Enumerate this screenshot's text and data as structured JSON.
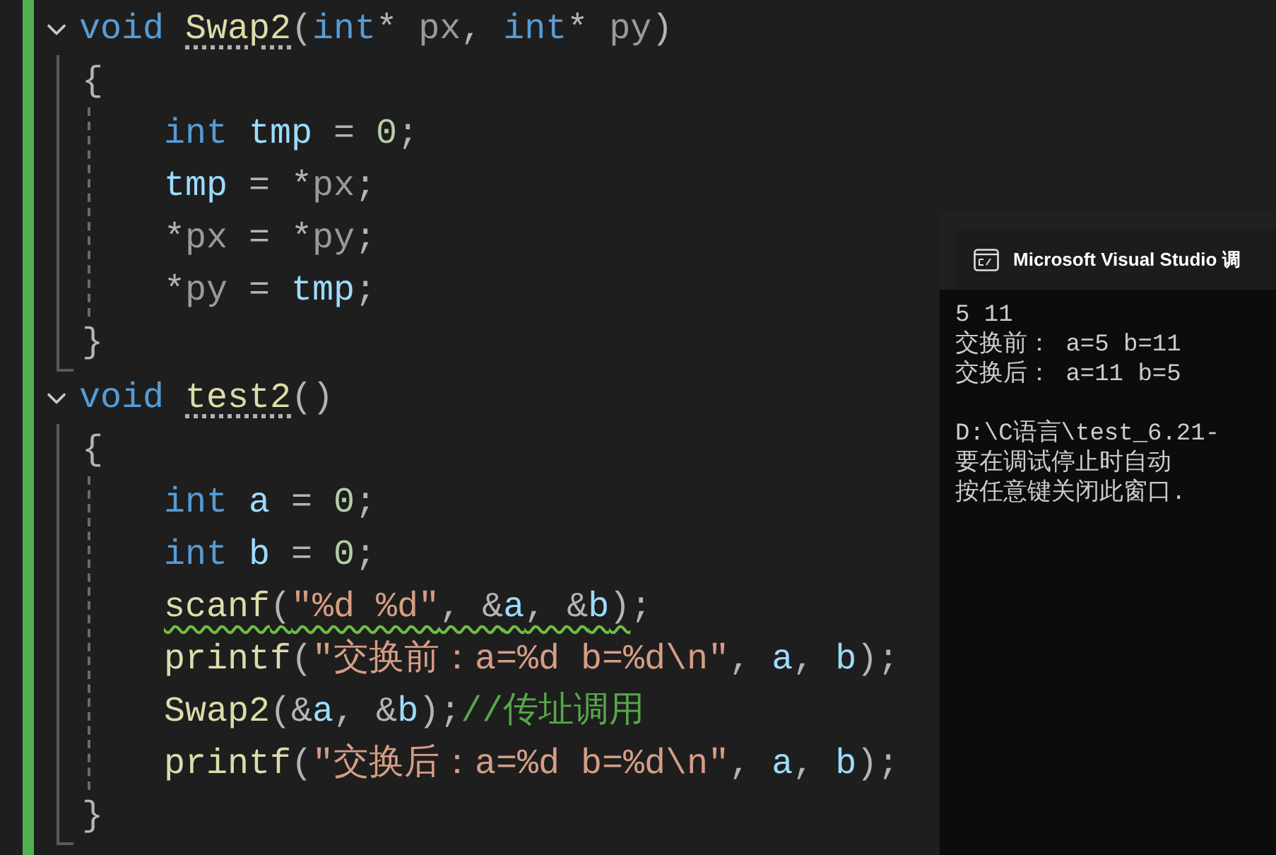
{
  "code": [
    {
      "expanded": true,
      "header": [
        {
          "text": "void ",
          "kind": "keyword"
        },
        {
          "text": "Swap2",
          "kind": "function_decl"
        },
        {
          "text": "(",
          "kind": "punct"
        },
        {
          "text": "int",
          "kind": "keyword"
        },
        {
          "text": "* ",
          "kind": "punct"
        },
        {
          "text": "px",
          "kind": "param"
        },
        {
          "text": ", ",
          "kind": "punct"
        },
        {
          "text": "int",
          "kind": "keyword"
        },
        {
          "text": "* ",
          "kind": "punct"
        },
        {
          "text": "py",
          "kind": "param"
        },
        {
          "text": ")",
          "kind": "punct"
        }
      ],
      "open": "{",
      "close": "}",
      "body": [
        {
          "tokens": [
            {
              "text": "int ",
              "kind": "keyword"
            },
            {
              "text": "tmp",
              "kind": "local"
            },
            {
              "text": " = ",
              "kind": "punct"
            },
            {
              "text": "0",
              "kind": "number"
            },
            {
              "text": ";",
              "kind": "punct"
            }
          ]
        },
        {
          "tokens": [
            {
              "text": "tmp",
              "kind": "local"
            },
            {
              "text": " = *",
              "kind": "punct"
            },
            {
              "text": "px",
              "kind": "param"
            },
            {
              "text": ";",
              "kind": "punct"
            }
          ]
        },
        {
          "tokens": [
            {
              "text": "*",
              "kind": "punct"
            },
            {
              "text": "px",
              "kind": "param"
            },
            {
              "text": " = *",
              "kind": "punct"
            },
            {
              "text": "py",
              "kind": "param"
            },
            {
              "text": ";",
              "kind": "punct"
            }
          ]
        },
        {
          "tokens": [
            {
              "text": "*",
              "kind": "punct"
            },
            {
              "text": "py",
              "kind": "param"
            },
            {
              "text": " = ",
              "kind": "punct"
            },
            {
              "text": "tmp",
              "kind": "local"
            },
            {
              "text": ";",
              "kind": "punct"
            }
          ]
        }
      ]
    },
    {
      "expanded": true,
      "header": [
        {
          "text": "void ",
          "kind": "keyword"
        },
        {
          "text": "test2",
          "kind": "function_decl"
        },
        {
          "text": "()",
          "kind": "punct"
        }
      ],
      "open": "{",
      "close": "}",
      "body": [
        {
          "tokens": [
            {
              "text": "int ",
              "kind": "keyword"
            },
            {
              "text": "a",
              "kind": "local"
            },
            {
              "text": " = ",
              "kind": "punct"
            },
            {
              "text": "0",
              "kind": "number"
            },
            {
              "text": ";",
              "kind": "punct"
            }
          ]
        },
        {
          "tokens": [
            {
              "text": "int ",
              "kind": "keyword"
            },
            {
              "text": "b",
              "kind": "local"
            },
            {
              "text": " = ",
              "kind": "punct"
            },
            {
              "text": "0",
              "kind": "number"
            },
            {
              "text": ";",
              "kind": "punct"
            }
          ]
        },
        {
          "tokens": [
            {
              "text": "scanf",
              "kind": "function",
              "warning": true
            },
            {
              "text": "(",
              "kind": "punct",
              "warning": true
            },
            {
              "text": "\"%d %d\"",
              "kind": "string",
              "warning": true
            },
            {
              "text": ", &",
              "kind": "punct",
              "warning": true
            },
            {
              "text": "a",
              "kind": "local",
              "warning": true
            },
            {
              "text": ", &",
              "kind": "punct",
              "warning": true
            },
            {
              "text": "b",
              "kind": "local",
              "warning": true
            },
            {
              "text": ")",
              "kind": "punct",
              "warning": true
            },
            {
              "text": ";",
              "kind": "punct",
              "warning": false
            }
          ]
        },
        {
          "tokens": [
            {
              "text": "printf",
              "kind": "function"
            },
            {
              "text": "(",
              "kind": "punct"
            },
            {
              "text": "\"交换前：a=%d b=%d\\n\"",
              "kind": "string"
            },
            {
              "text": ", ",
              "kind": "punct"
            },
            {
              "text": "a",
              "kind": "local"
            },
            {
              "text": ", ",
              "kind": "punct"
            },
            {
              "text": "b",
              "kind": "local"
            },
            {
              "text": ");",
              "kind": "punct"
            }
          ]
        },
        {
          "tokens": [
            {
              "text": "Swap2",
              "kind": "function"
            },
            {
              "text": "(&",
              "kind": "punct"
            },
            {
              "text": "a",
              "kind": "local"
            },
            {
              "text": ", &",
              "kind": "punct"
            },
            {
              "text": "b",
              "kind": "local"
            },
            {
              "text": ");",
              "kind": "punct"
            },
            {
              "text": "//传址调用",
              "kind": "comment"
            }
          ]
        },
        {
          "tokens": [
            {
              "text": "printf",
              "kind": "function"
            },
            {
              "text": "(",
              "kind": "punct"
            },
            {
              "text": "\"交换后：a=%d b=%d\\n\"",
              "kind": "string"
            },
            {
              "text": ", ",
              "kind": "punct"
            },
            {
              "text": "a",
              "kind": "local"
            },
            {
              "text": ", ",
              "kind": "punct"
            },
            {
              "text": "b",
              "kind": "local"
            },
            {
              "text": ");",
              "kind": "punct"
            }
          ]
        }
      ]
    }
  ],
  "console": {
    "title": "Microsoft Visual Studio 调",
    "blocks": [
      [
        "5 11",
        "交换前： a=5 b=11",
        "交换后： a=11 b=5"
      ],
      [
        "D:\\C语言\\test_6.21-",
        "要在调试停止时自动",
        "按任意键关闭此窗口."
      ]
    ]
  }
}
